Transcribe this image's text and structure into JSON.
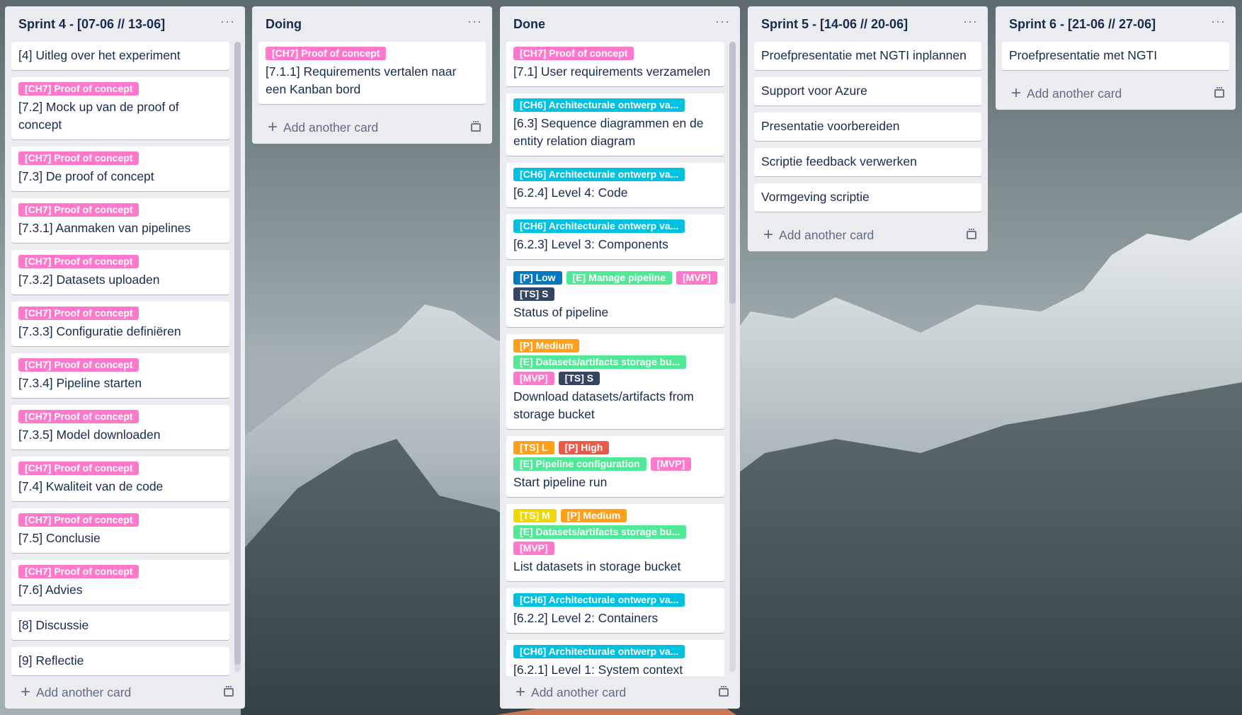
{
  "colors": {
    "pink": "#ff78cb",
    "cyan": "#00c2e0",
    "green": "#51e898",
    "blue": "#0079bf",
    "navy": "#344563",
    "orange": "#ff9f1a",
    "red": "#eb5a46",
    "yellow": "#f2d600"
  },
  "add_card_label": "Add another card",
  "columns": [
    {
      "title": "Sprint 4 - [07-06 // 13-06]",
      "scroll": true,
      "cards": [
        {
          "labels": [],
          "title": "[4] Uitleg over het experiment"
        },
        {
          "labels": [
            {
              "text": "[CH7] Proof of concept",
              "color": "pink"
            }
          ],
          "title": "[7.2] Mock up van de proof of concept"
        },
        {
          "labels": [
            {
              "text": "[CH7] Proof of concept",
              "color": "pink"
            }
          ],
          "title": "[7.3] De proof of concept"
        },
        {
          "labels": [
            {
              "text": "[CH7] Proof of concept",
              "color": "pink"
            }
          ],
          "title": "[7.3.1] Aanmaken van pipelines"
        },
        {
          "labels": [
            {
              "text": "[CH7] Proof of concept",
              "color": "pink"
            }
          ],
          "title": "[7.3.2] Datasets uploaden"
        },
        {
          "labels": [
            {
              "text": "[CH7] Proof of concept",
              "color": "pink"
            }
          ],
          "title": "[7.3.3] Configuratie definiëren"
        },
        {
          "labels": [
            {
              "text": "[CH7] Proof of concept",
              "color": "pink"
            }
          ],
          "title": "[7.3.4] Pipeline starten"
        },
        {
          "labels": [
            {
              "text": "[CH7] Proof of concept",
              "color": "pink"
            }
          ],
          "title": "[7.3.5] Model downloaden"
        },
        {
          "labels": [
            {
              "text": "[CH7] Proof of concept",
              "color": "pink"
            }
          ],
          "title": "[7.4] Kwaliteit van de code"
        },
        {
          "labels": [
            {
              "text": "[CH7] Proof of concept",
              "color": "pink"
            }
          ],
          "title": "[7.5] Conclusie"
        },
        {
          "labels": [
            {
              "text": "[CH7] Proof of concept",
              "color": "pink"
            }
          ],
          "title": "[7.6] Advies"
        },
        {
          "labels": [],
          "title": "[8] Discussie"
        },
        {
          "labels": [],
          "title": "[9] Reflectie"
        }
      ]
    },
    {
      "title": "Doing",
      "scroll": false,
      "cards": [
        {
          "labels": [
            {
              "text": "[CH7] Proof of concept",
              "color": "pink"
            }
          ],
          "title": "[7.1.1] Requirements vertalen naar een Kanban bord"
        }
      ]
    },
    {
      "title": "Done",
      "scroll": true,
      "cards": [
        {
          "labels": [
            {
              "text": "[CH7] Proof of concept",
              "color": "pink"
            }
          ],
          "title": "[7.1] User requirements verzamelen"
        },
        {
          "labels": [
            {
              "text": "[CH6] Architecturale ontwerp va...",
              "color": "cyan"
            }
          ],
          "title": "[6.3] Sequence diagrammen en de entity relation diagram"
        },
        {
          "labels": [
            {
              "text": "[CH6] Architecturale ontwerp va...",
              "color": "cyan"
            }
          ],
          "title": "[6.2.4] Level 4: Code"
        },
        {
          "labels": [
            {
              "text": "[CH6] Architecturale ontwerp va...",
              "color": "cyan"
            }
          ],
          "title": "[6.2.3] Level 3: Components"
        },
        {
          "labels": [
            {
              "text": "[P] Low",
              "color": "blue"
            },
            {
              "text": "[E] Manage pipeline",
              "color": "green"
            },
            {
              "text": "[MVP]",
              "color": "pink"
            },
            {
              "text": "[TS] S",
              "color": "navy"
            }
          ],
          "title": "Status of pipeline"
        },
        {
          "labels": [
            {
              "text": "[P] Medium",
              "color": "orange"
            },
            {
              "text": "[E] Datasets/artifacts storage bu...",
              "color": "green"
            },
            {
              "text": "[MVP]",
              "color": "pink"
            },
            {
              "text": "[TS] S",
              "color": "navy"
            }
          ],
          "title": "Download datasets/artifacts from storage bucket"
        },
        {
          "labels": [
            {
              "text": "[TS] L",
              "color": "orange"
            },
            {
              "text": "[P] High",
              "color": "red"
            },
            {
              "text": "[E] Pipeline configuration",
              "color": "green"
            },
            {
              "text": "[MVP]",
              "color": "pink"
            }
          ],
          "title": "Start pipeline run"
        },
        {
          "labels": [
            {
              "text": "[TS] M",
              "color": "yellow"
            },
            {
              "text": "[P] Medium",
              "color": "orange"
            },
            {
              "text": "[E] Datasets/artifacts storage bu...",
              "color": "green"
            },
            {
              "text": "[MVP]",
              "color": "pink"
            }
          ],
          "title": "List datasets in storage bucket"
        },
        {
          "labels": [
            {
              "text": "[CH6] Architecturale ontwerp va...",
              "color": "cyan"
            }
          ],
          "title": "[6.2.2] Level 2: Containers"
        },
        {
          "labels": [
            {
              "text": "[CH6] Architecturale ontwerp va...",
              "color": "cyan"
            }
          ],
          "title": "[6.2.1] Level 1: System context"
        }
      ]
    },
    {
      "title": "Sprint 5 - [14-06 // 20-06]",
      "scroll": false,
      "cards": [
        {
          "labels": [],
          "title": "Proefpresentatie met NGTI inplannen"
        },
        {
          "labels": [],
          "title": "Support voor Azure"
        },
        {
          "labels": [],
          "title": "Presentatie voorbereiden"
        },
        {
          "labels": [],
          "title": "Scriptie feedback verwerken"
        },
        {
          "labels": [],
          "title": "Vormgeving scriptie"
        }
      ]
    },
    {
      "title": "Sprint 6 - [21-06 // 27-06]",
      "scroll": false,
      "cards": [
        {
          "labels": [],
          "title": "Proefpresentatie met NGTI"
        }
      ]
    }
  ]
}
